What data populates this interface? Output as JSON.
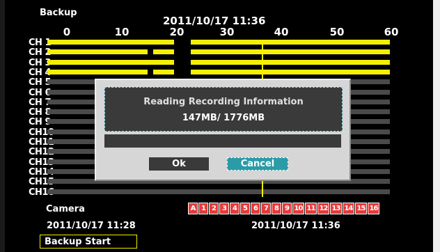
{
  "header": {
    "title": "Backup",
    "datetime": "2011/10/17  11:36"
  },
  "timeline": {
    "ruler_labels": [
      "0",
      "10",
      "20",
      "30",
      "40",
      "50",
      "60"
    ],
    "channels": [
      "CH 1",
      "CH 2",
      "CH 3",
      "CH 4",
      "CH 5",
      "CH 6",
      "CH 7",
      "CH 8",
      "CH 9",
      "CH10",
      "CH11",
      "CH12",
      "CH13",
      "CH14",
      "CH15",
      "CH16"
    ],
    "recorded_channels": [
      1,
      2,
      3,
      4
    ]
  },
  "dialog": {
    "title": "Reading Recording Information",
    "size_text": "147MB/  1776MB",
    "progress_fraction": 0.0,
    "ok_label": "Ok",
    "cancel_label": "Cancel"
  },
  "camera": {
    "label": "Camera",
    "all_label": "A",
    "numbers": [
      "1",
      "2",
      "3",
      "4",
      "5",
      "6",
      "7",
      "8",
      "9",
      "10",
      "11",
      "12",
      "13",
      "14",
      "15",
      "16"
    ]
  },
  "range": {
    "start": "2011/10/17  11:28",
    "end": "2011/10/17  11:36"
  },
  "footer": {
    "backup_start_label": "Backup Start"
  },
  "colors": {
    "record": "#f4f000",
    "empty_track": "#4a4a4a",
    "camera_cell": "#e83a3a",
    "progress": "#22c7d8"
  }
}
